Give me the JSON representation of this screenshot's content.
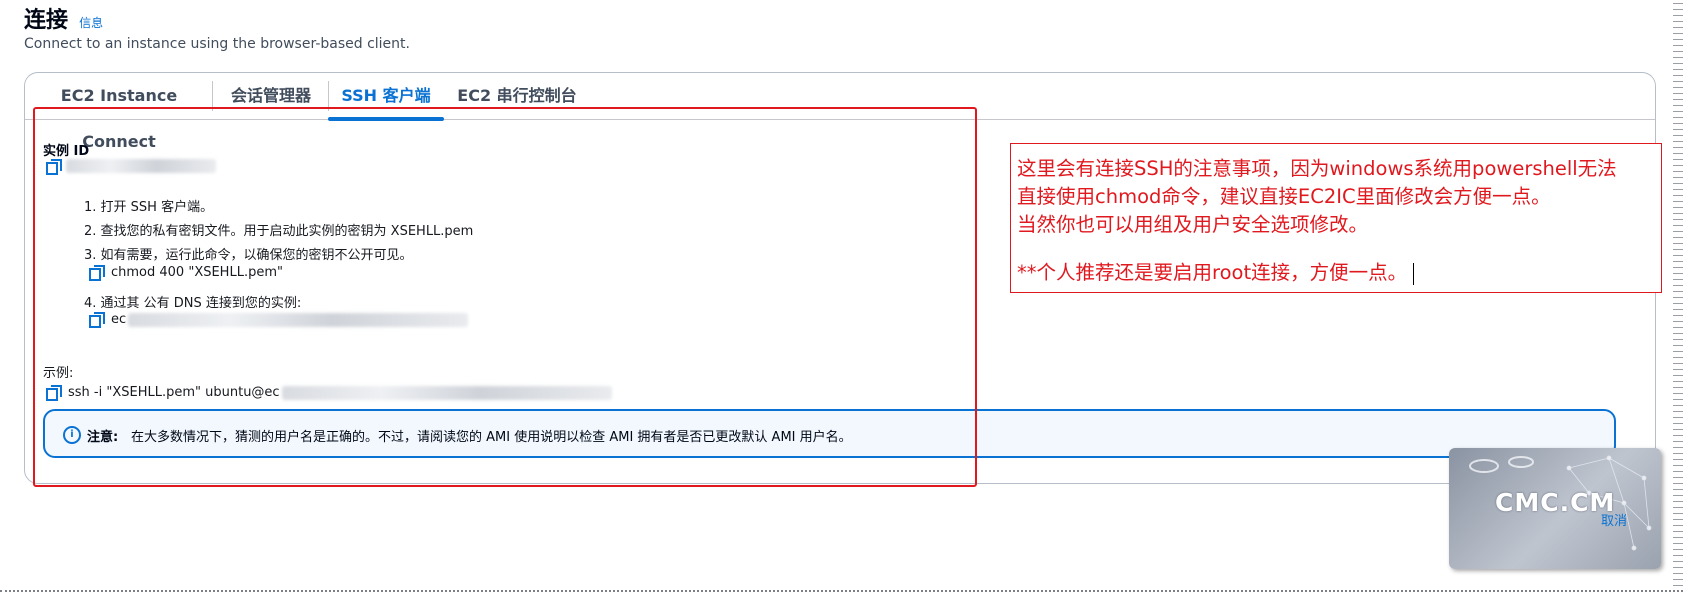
{
  "page": {
    "title": "连接",
    "info_link": "信息",
    "description": "Connect to an instance using the browser-based client."
  },
  "tabs": [
    {
      "label": "EC2 Instance Connect",
      "active": false
    },
    {
      "label": "会话管理器",
      "active": false
    },
    {
      "label": "SSH 客户端",
      "active": true
    },
    {
      "label": "EC2 串行控制台",
      "active": false
    }
  ],
  "ssh": {
    "instance_id_label": "实例 ID",
    "steps": [
      "1. 打开 SSH 客户端。",
      "2. 查找您的私有密钥文件。用于启动此实例的密钥为 XSEHLL.pem",
      "3. 如有需要，运行此命令，以确保您的密钥不公开可见。",
      "4. 通过其 公有 DNS 连接到您的实例:"
    ],
    "chmod_command": "chmod 400 \"XSEHLL.pem\"",
    "dns_prefix": "ec",
    "example_label": "示例:",
    "example_command_prefix": "ssh -i \"XSEHLL.pem\" ubuntu@ec"
  },
  "alert": {
    "title": "注意:",
    "body": "在大多数情况下，猜测的用户名是正确的。不过，请阅读您的 AMI 使用说明以检查 AMI 拥有者是否已更改默认 AMI 用户名。"
  },
  "annotation": {
    "lines": [
      "这里会有连接SSH的注意事项，因为windows系统用powershell无法",
      "直接使用chmod命令，建议直接EC2IC里面修改会方便一点。",
      "当然你也可以用组及用户安全选项修改。",
      "**个人推荐还是要启用root连接，方便一点。"
    ]
  },
  "watermark": {
    "logo": "CMC.CM",
    "cancel": "取消"
  },
  "colors": {
    "accent": "#0972d3",
    "annotation_red": "#e0191f",
    "text": "#16191f"
  },
  "icons": [
    "copy-icon",
    "info-icon"
  ]
}
